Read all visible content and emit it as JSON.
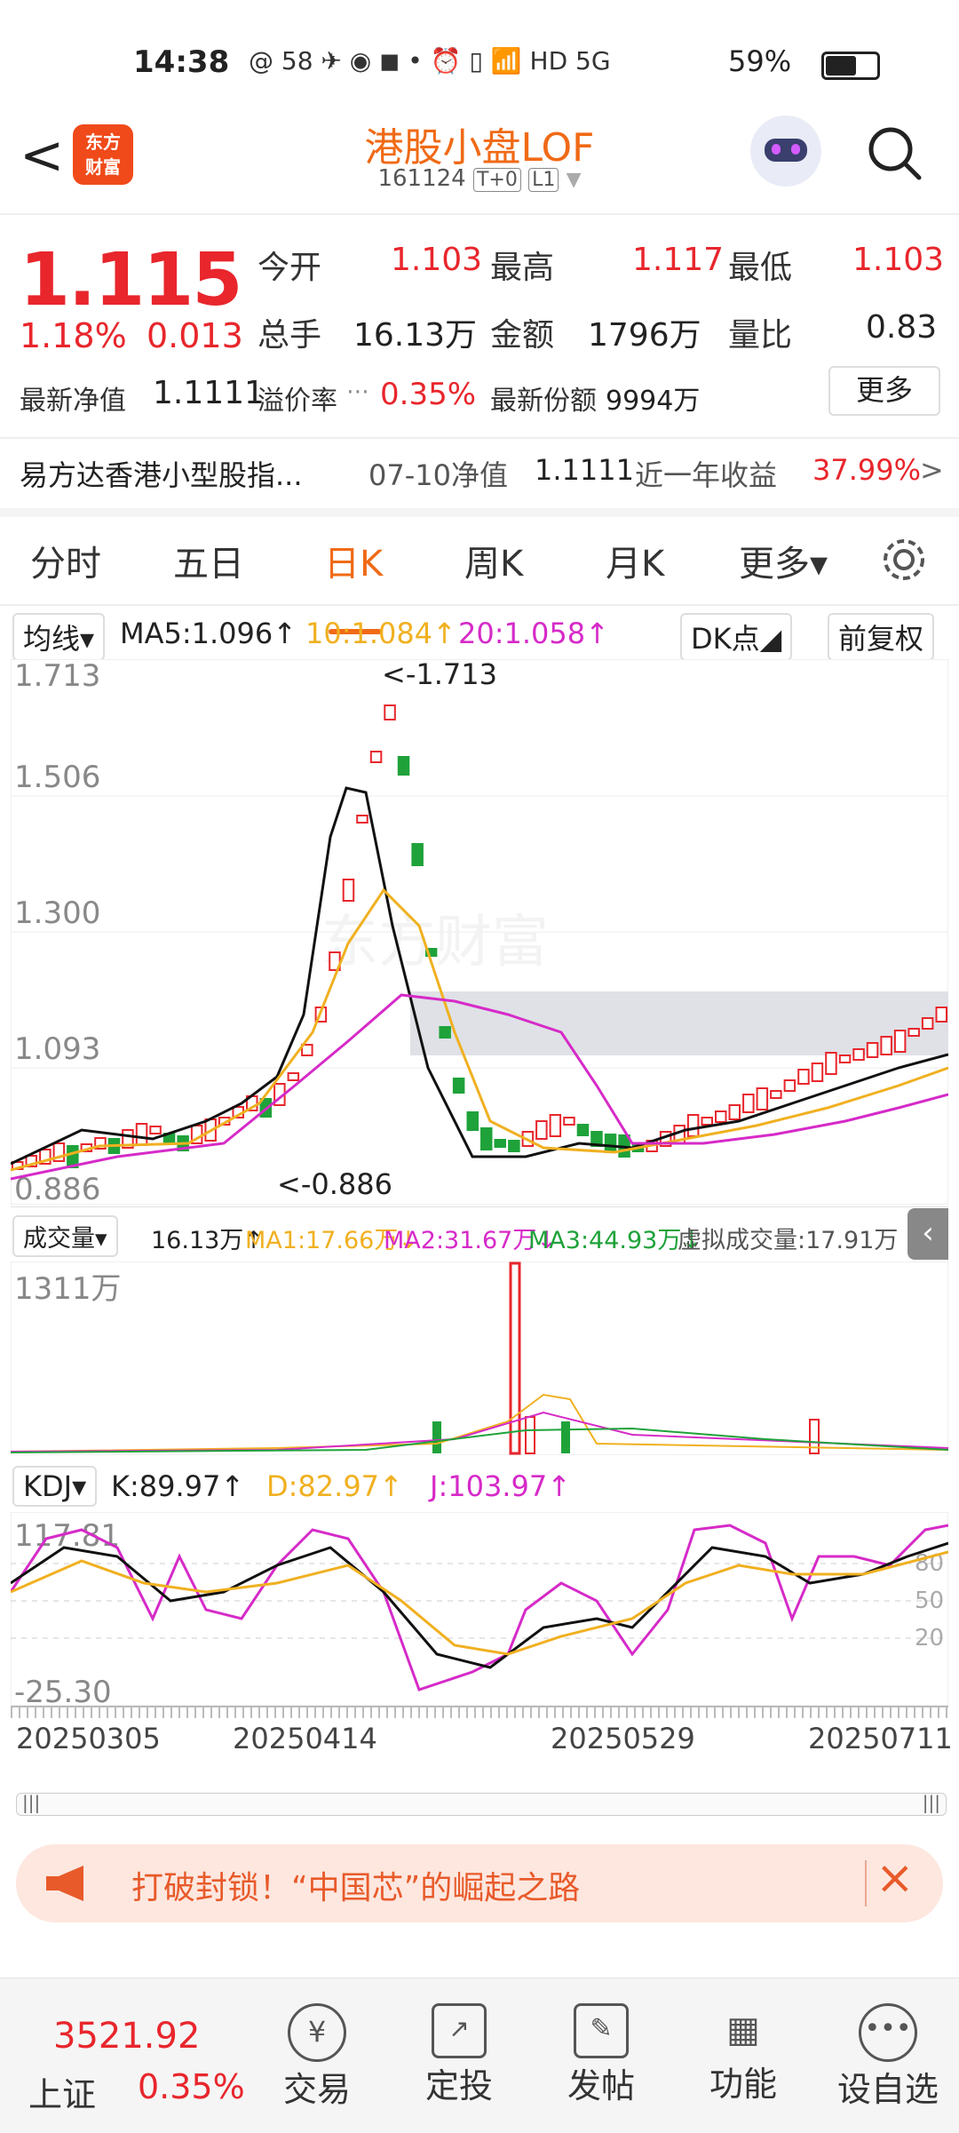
{
  "status": {
    "time": "14:38",
    "icons": "@ 58 ✈ ◉ ◼ • ⏰ ▯ 📶 HD 5G",
    "battery": "59%"
  },
  "header": {
    "logo_line1": "东方",
    "logo_line2": "财富",
    "title": "港股小盘LOF",
    "code": "161124",
    "tag1": "T+0",
    "tag2": "L1",
    "dropdown": "▼"
  },
  "quote": {
    "price": "1.115",
    "pct": "1.18%",
    "chg": "0.013",
    "open_label": "今开",
    "open": "1.103",
    "high_label": "最高",
    "high": "1.117",
    "low_label": "最低",
    "low": "1.103",
    "vol_label": "总手",
    "vol": "16.13万",
    "amt_label": "金额",
    "amt": "1796万",
    "ratio_label": "量比",
    "ratio": "0.83",
    "nav_label": "最新净值",
    "nav": "1.1111",
    "prem_label": "溢价率",
    "prem": "0.35%",
    "share_label": "最新份额",
    "share": "9994万",
    "more": "更多"
  },
  "fund": {
    "name": "易方达香港小型股指...",
    "nav_date": "07-10净值",
    "nav": "1.1111",
    "year_label": "近一年收益",
    "year": "37.99%",
    "arrow": ">"
  },
  "tabs": [
    "分时",
    "五日",
    "日K",
    "周K",
    "月K",
    "更多▾"
  ],
  "ma": {
    "select": "均线▾",
    "ma5": "MA5:1.096↑",
    "ma10": "10:1.084↑",
    "ma20": "20:1.058↑",
    "dk": "DK点◢",
    "adj": "前复权"
  },
  "chart": {
    "y_labels": [
      "1.713",
      "1.506",
      "1.300",
      "1.093",
      "0.886"
    ],
    "max_label": "<-1.713",
    "min_label": "<-0.886",
    "watermark": "东方财富"
  },
  "volume": {
    "select": "成交量▾",
    "v": "16.13万↑",
    "ma1": "MA1:17.66万↓",
    "ma2": "MA2:31.67万↓",
    "ma3": "MA3:44.93万↓",
    "virt": "虚拟成交量:17.91万",
    "max": "1311万"
  },
  "kdj": {
    "select": "KDJ▾",
    "k": "K:89.97↑",
    "d": "D:82.97↑",
    "j": "J:103.97↑",
    "top": "117.81",
    "bottom": "-25.30",
    "l80": "80",
    "l50": "50",
    "l20": "20"
  },
  "dates": [
    "20250305",
    "20250414",
    "20250529",
    "20250711"
  ],
  "banner": {
    "text": "打破封锁！“中国芯”的崛起之路"
  },
  "bottom": {
    "index_value": "3521.92",
    "index_name": "上证",
    "index_pct": "0.35%",
    "items": [
      "交易",
      "定投",
      "发帖",
      "功能",
      "设自选"
    ]
  },
  "colors": {
    "red": "#e8262c",
    "green": "#1fa23a",
    "orange": "#f06a16",
    "magenta": "#d62ac8",
    "yellow": "#f0b020"
  }
}
